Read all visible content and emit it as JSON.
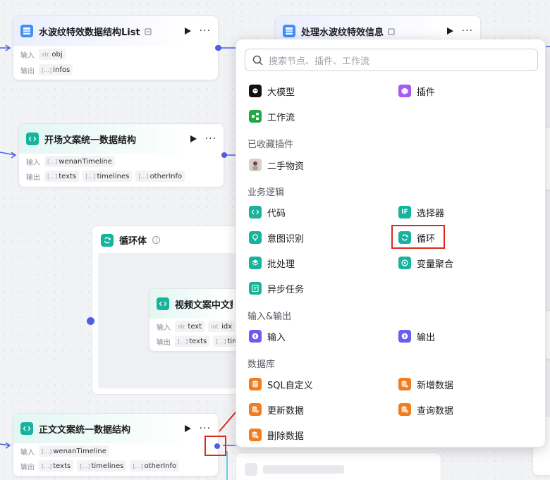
{
  "nodes": {
    "ripple_list": {
      "title": "水波纹特效数据结构List",
      "input_label": "输入",
      "output_label": "输出",
      "inputs": [
        {
          "type": "str.",
          "name": "obj"
        }
      ],
      "outputs": [
        {
          "type": "[…]",
          "name": "infos"
        }
      ]
    },
    "process_ripple": {
      "title": "处理水波纹特效信息"
    },
    "opening_struct": {
      "title": "开场文案统一数据结构",
      "input_label": "输入",
      "output_label": "输出",
      "inputs": [
        {
          "type": "[…]",
          "name": "wenanTimeline"
        }
      ],
      "outputs": [
        {
          "type": "[…]",
          "name": "texts"
        },
        {
          "type": "[…]",
          "name": "timelines"
        },
        {
          "type": "[…]",
          "name": "otherInfo"
        }
      ]
    },
    "loop_body": {
      "title": "循环体"
    },
    "video_text": {
      "title": "视频文案中文数",
      "input_label": "输入",
      "output_label": "输出",
      "inputs": [
        {
          "type": "str.",
          "name": "text"
        },
        {
          "type": "int.",
          "name": "idx"
        }
      ],
      "outputs": [
        {
          "type": "[…]",
          "name": "texts"
        },
        {
          "type": "[…]",
          "name": "time"
        }
      ]
    },
    "body_struct": {
      "title": "正文文案统一数据结构",
      "input_label": "输入",
      "output_label": "输出",
      "inputs": [
        {
          "type": "[…]",
          "name": "wenanTimeline"
        }
      ],
      "outputs": [
        {
          "type": "[…]",
          "name": "texts"
        },
        {
          "type": "[…]",
          "name": "timelines"
        },
        {
          "type": "[…]",
          "name": "otherInfo"
        }
      ]
    }
  },
  "menu": {
    "search_placeholder": "搜索节点、插件、工作流",
    "top_items": [
      "大模型",
      "插件",
      "工作流"
    ],
    "sections": {
      "favorites": "已收藏插件",
      "logic": "业务逻辑",
      "io": "输入&输出",
      "db": "数据库"
    },
    "favorites": [
      "二手物资"
    ],
    "logic": [
      "代码",
      "选择器",
      "意图识别",
      "循环",
      "批处理",
      "变量聚合",
      "异步任务"
    ],
    "io": [
      "输入",
      "输出"
    ],
    "db": [
      "SQL自定义",
      "新增数据",
      "更新数据",
      "查询数据",
      "删除数据"
    ]
  },
  "colors": {
    "teal": "#17b39d",
    "purple": "#6b5cf0",
    "edge": "#4e5ee4",
    "db_orange": "#f07d20",
    "flow_green": "#22a646",
    "highlight_red": "#e0281d"
  }
}
